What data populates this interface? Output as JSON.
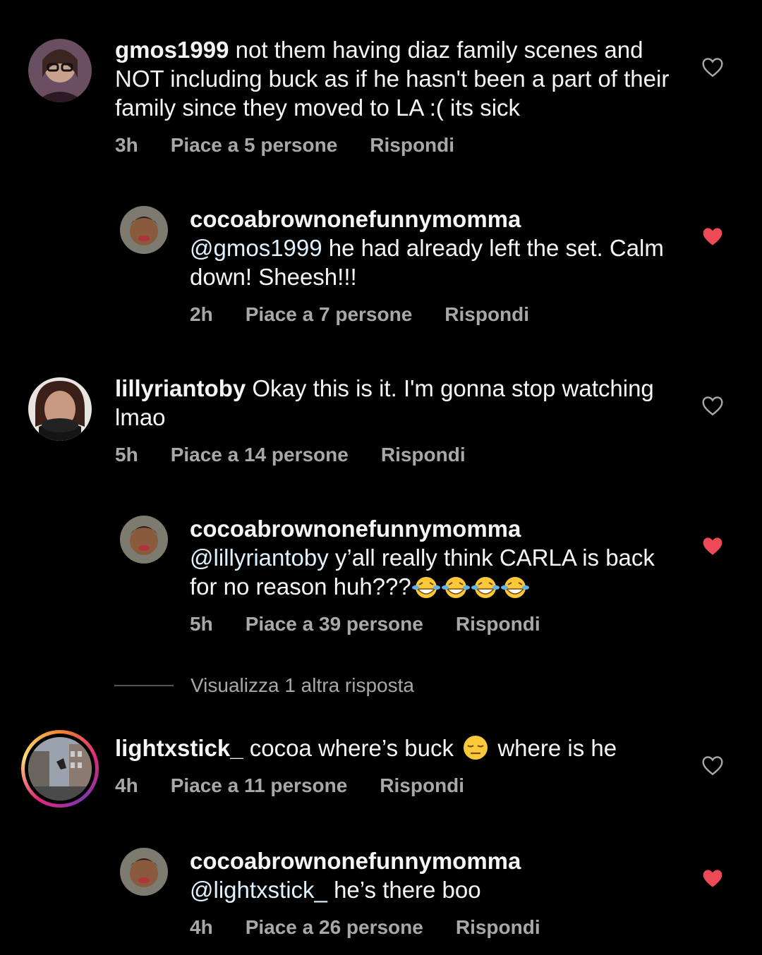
{
  "comments": [
    {
      "username": "gmos1999",
      "text": "not them having diaz family scenes and NOT including buck as if he hasn't been a part of their family since they moved to LA :( its sick",
      "time": "3h",
      "likes": "Piace a 5 persone",
      "reply": "Rispondi",
      "liked": false
    },
    {
      "username": "cocoabrownonefunnymomma",
      "mention": "@gmos1999",
      "text": "he had already left the set. Calm down! Sheesh!!!",
      "time": "2h",
      "likes": "Piace a 7 persone",
      "reply": "Rispondi",
      "liked": true
    },
    {
      "username": "lillyriantoby",
      "text": "Okay this is it. I'm gonna stop watching lmao",
      "time": "5h",
      "likes": "Piace a 14 persone",
      "reply": "Rispondi",
      "liked": false
    },
    {
      "username": "cocoabrownonefunnymomma",
      "mention": "@lillyriantoby",
      "text": "y’all really think CARLA is back for no reason huh???",
      "time": "5h",
      "likes": "Piace a 39 persone",
      "reply": "Rispondi",
      "liked": true
    },
    {
      "username": "lightxstick_",
      "text_a": "cocoa where’s buck",
      "text_b": "where is he",
      "time": "4h",
      "likes": "Piace a 11 persone",
      "reply": "Rispondi",
      "liked": false
    },
    {
      "username": "cocoabrownonefunnymomma",
      "mention": "@lightxstick_",
      "text": "he’s there boo",
      "time": "4h",
      "likes": "Piace a 26 persone",
      "reply": "Rispondi",
      "liked": true
    }
  ],
  "view_more": "Visualizza 1 altra risposta",
  "colors": {
    "liked_heart": "#ed4956",
    "muted": "#a8a8a8",
    "background": "#000000"
  },
  "icons": [
    "heart-outline-icon",
    "heart-filled-icon",
    "tears-of-joy-emoji",
    "expressionless-emoji"
  ]
}
